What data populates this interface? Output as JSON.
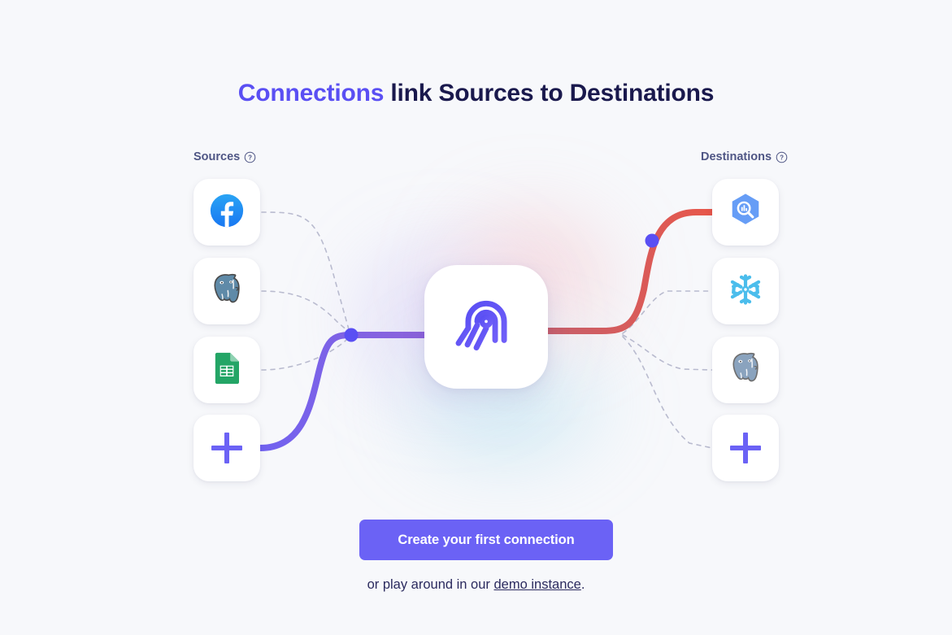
{
  "page": {
    "background_color": "#f7f8fb",
    "title_prefix": "Connections",
    "title_rest": " link Sources to Destinations",
    "accent_color": "#5a4ff3",
    "title_color": "#1a194d"
  },
  "sources": {
    "label": "Sources",
    "help_icon": "question-circle-icon",
    "items": [
      {
        "name": "Facebook",
        "icon": "facebook-icon",
        "color": "#1877F2",
        "connected": false
      },
      {
        "name": "Postgres",
        "icon": "postgres-elephant-icon",
        "color": "#31648C",
        "connected": false
      },
      {
        "name": "Google Sheets",
        "icon": "google-sheets-icon",
        "color": "#23A566",
        "connected": false
      },
      {
        "name": "Add source",
        "icon": "plus-icon",
        "color": "#6b62f5",
        "connected": true
      }
    ]
  },
  "destinations": {
    "label": "Destinations",
    "help_icon": "question-circle-icon",
    "items": [
      {
        "name": "BigQuery",
        "icon": "bigquery-icon",
        "color": "#669DF6",
        "connected": true
      },
      {
        "name": "Snowflake",
        "icon": "snowflake-icon",
        "color": "#29B5E8",
        "connected": false
      },
      {
        "name": "Postgres",
        "icon": "postgres-elephant-icon",
        "color": "#8AA3BE",
        "connected": false
      },
      {
        "name": "Add destination",
        "icon": "plus-icon",
        "color": "#8b83f7",
        "connected": false
      }
    ]
  },
  "center": {
    "logo": "airbyte-logo",
    "logo_color": "#5a4ff3"
  },
  "connections": {
    "source_line_color": "#6b62f5",
    "destination_line_color": "#e0544c",
    "node_dot_color": "#5a4ff3",
    "inactive_line_color": "#b9bbcf"
  },
  "cta": {
    "button_label": "Create your first connection",
    "button_color": "#6b62f5",
    "footer_prefix": "or play around in our ",
    "footer_link": "demo instance",
    "footer_suffix": "."
  }
}
